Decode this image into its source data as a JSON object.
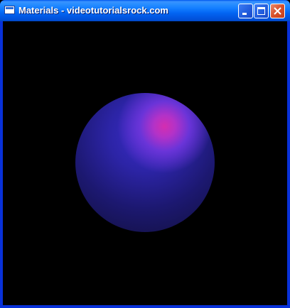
{
  "window": {
    "title": "Materials - videotutorialsrock.com"
  },
  "titlebar_buttons": {
    "minimize": "minimize",
    "maximize": "maximize",
    "close": "close"
  },
  "scene": {
    "background_color": "#000000",
    "object": "sphere",
    "sphere_color": "#2c24a6",
    "highlight_color": "#d42eb0"
  }
}
